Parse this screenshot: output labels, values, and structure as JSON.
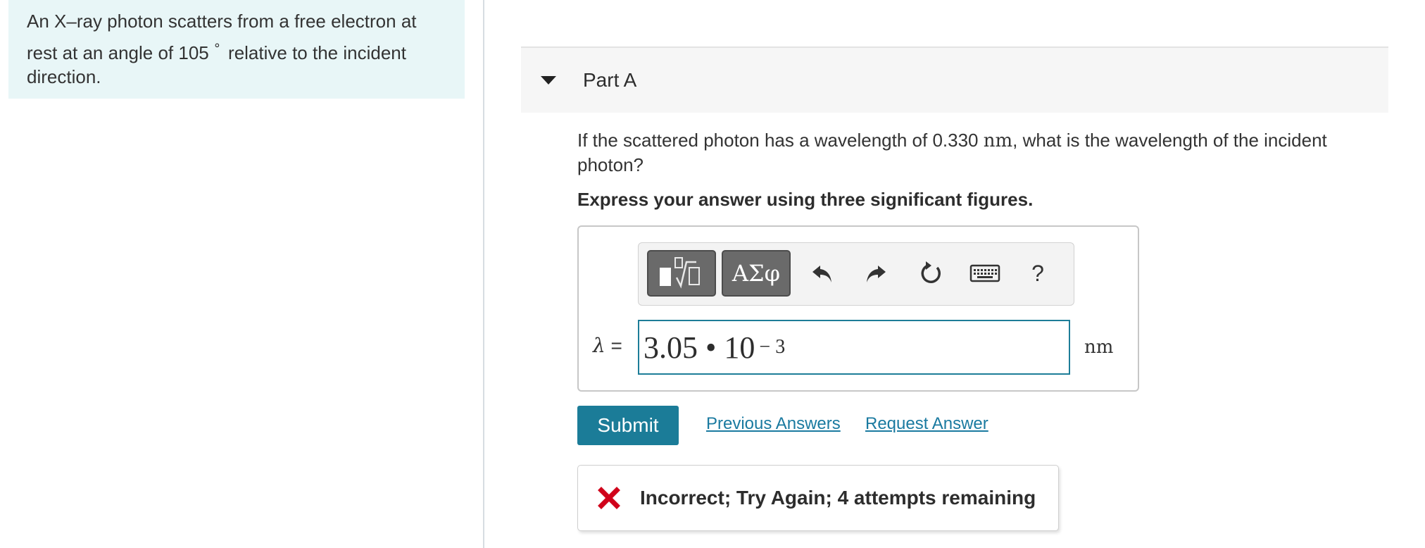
{
  "problem": {
    "intro_part1": "An X–ray photon scatters from a free electron at rest at an angle of 105",
    "degree_symbol": "∘",
    "intro_part2": "relative to the incident direction."
  },
  "part": {
    "title": "Part A",
    "question_part1": "If the scattered photon has a wavelength of 0.330",
    "question_unit": "nm",
    "question_part2": ", what is the wavelength of the incident photon?",
    "instruction": "Express your answer using three significant figures."
  },
  "toolbar": {
    "templates_icon": "sqrt-templates-icon",
    "greek_label": "ΑΣφ",
    "undo_icon": "undo-icon",
    "redo_icon": "redo-icon",
    "reset_icon": "reset-icon",
    "keyboard_icon": "keyboard-icon",
    "help_label": "?"
  },
  "answer": {
    "variable": "λ",
    "equals": "=",
    "mantissa": "3.05 • 10",
    "exponent": "− 3",
    "unit": "nm"
  },
  "actions": {
    "submit_label": "Submit",
    "previous_answers": "Previous Answers",
    "request_answer": "Request Answer"
  },
  "feedback": {
    "icon": "x-icon",
    "text": "Incorrect; Try Again; 4 attempts remaining",
    "color": "#d0021b"
  },
  "colors": {
    "accent": "#1b7c98",
    "intro_bg": "#e8f6f7",
    "link": "#1a7aa0"
  }
}
